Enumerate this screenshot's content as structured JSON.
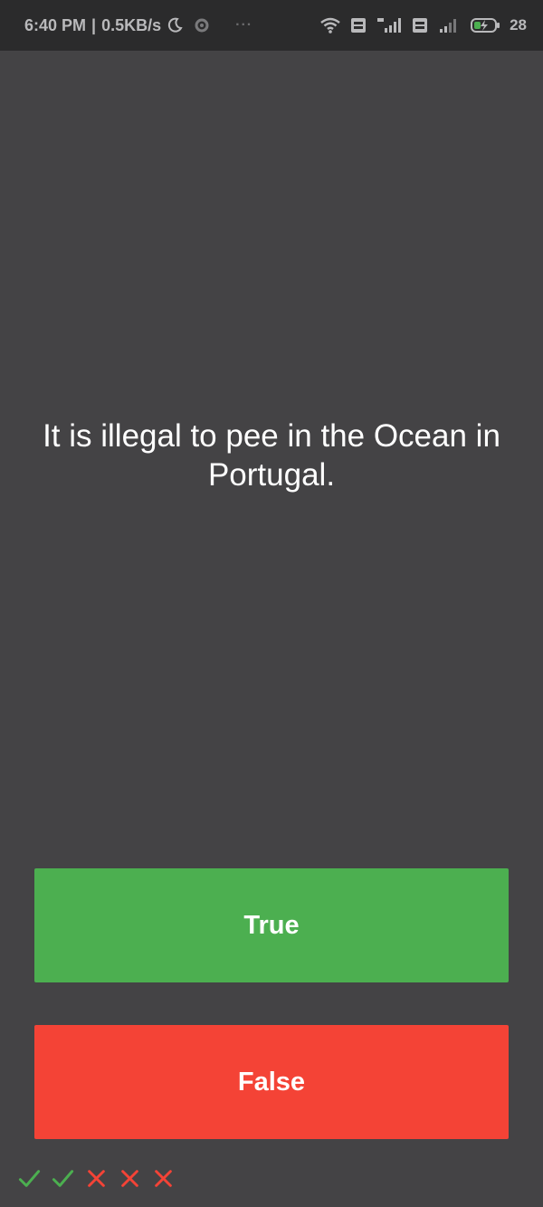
{
  "status_bar": {
    "time": "6:40 PM",
    "separator": "|",
    "net_speed": "0.5KB/s",
    "dots": "···",
    "battery_percent": "28",
    "icons": [
      "moon-icon",
      "sync-icon",
      "wifi-icon",
      "volte-icon",
      "signal-4g-icon",
      "volte-icon-2",
      "signal-icon-2",
      "battery-charging-icon"
    ]
  },
  "question": {
    "text": "It is illegal to pee in the Ocean in Portugal."
  },
  "buttons": {
    "true_label": "True",
    "false_label": "False",
    "true_color": "#4caf50",
    "false_color": "#f44336"
  },
  "score_keeper": {
    "results": [
      "correct",
      "correct",
      "wrong",
      "wrong",
      "wrong"
    ],
    "correct_color": "#4caf50",
    "wrong_color": "#f44336"
  },
  "colors": {
    "background": "#444345",
    "status_bar": "#2b2b2c"
  }
}
